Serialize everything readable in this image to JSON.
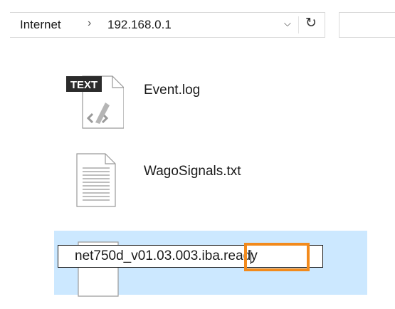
{
  "address_bar": {
    "crumbs": [
      "Internet",
      "192.168.0.1"
    ],
    "separator": "›",
    "dropdown_glyph": "⌵",
    "refresh_glyph": "↻"
  },
  "files": [
    {
      "name": "Event.log",
      "icon": "text-log-file-icon",
      "badge": "TEXT"
    },
    {
      "name": "WagoSignals.txt",
      "icon": "text-document-icon"
    },
    {
      "name": "net750d_v01.03.003.iba.ready",
      "icon": "generic-file-icon",
      "selected": true,
      "renaming": true
    }
  ],
  "rename": {
    "value": "net750d_v01.03.003.iba.ready",
    "highlighted_suffix": ".ready"
  },
  "colors": {
    "selection": "#cce8ff",
    "highlight": "#f28a1c"
  }
}
